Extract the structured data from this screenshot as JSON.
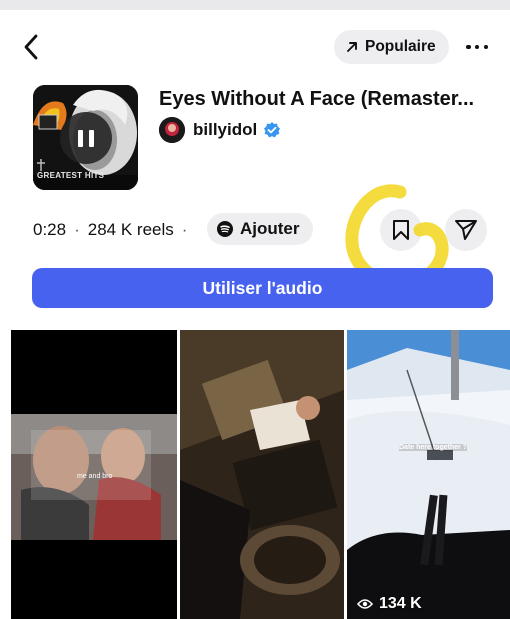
{
  "header": {
    "popular_label": "Populaire"
  },
  "track": {
    "title": "Eyes Without A Face (Remaster...",
    "artist": "billyidol",
    "album_cover_text": "GREATEST HITS"
  },
  "stats": {
    "time": "0:28",
    "reels": "284 K reels",
    "separator": "·",
    "add_label": "Ajouter"
  },
  "use_audio_label": "Utiliser l'audio",
  "reels": [
    {
      "caption": "me and bro",
      "views": ""
    },
    {
      "caption": "",
      "views": ""
    },
    {
      "caption": "Date here together ?",
      "views": "134 K"
    }
  ],
  "colors": {
    "primary_button": "#4862f0",
    "verified_badge": "#3797f0",
    "highlight_annotation": "#f2d51c"
  }
}
